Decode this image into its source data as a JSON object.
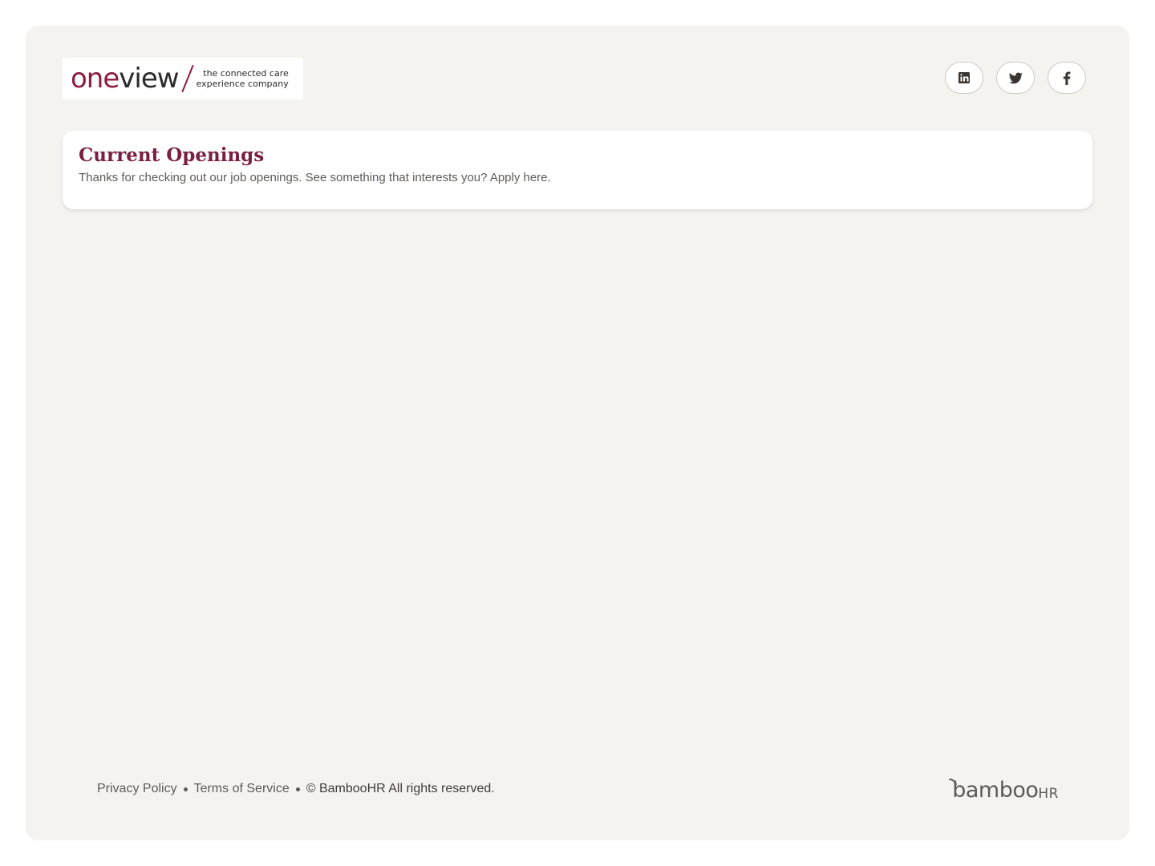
{
  "header": {
    "logo": {
      "word_one": "one",
      "word_view": "view",
      "tagline_line1": "the connected care",
      "tagline_line2": "experience company"
    },
    "social": [
      {
        "name": "linkedin",
        "icon": "linkedin-icon"
      },
      {
        "name": "twitter",
        "icon": "twitter-icon"
      },
      {
        "name": "facebook",
        "icon": "facebook-icon"
      }
    ]
  },
  "openings": {
    "title": "Current Openings",
    "subtitle": "Thanks for checking out our job openings. See something that interests you? Apply here."
  },
  "footer": {
    "privacy_label": "Privacy Policy",
    "terms_label": "Terms of Service",
    "copyright_symbol": "©",
    "copyright_text": "BambooHR All rights reserved.",
    "brand_main": "bamboo",
    "brand_suffix": "HR"
  },
  "colors": {
    "brand": "#7a1f43",
    "background": "#f5f3f0",
    "text_muted": "#5f5a55"
  }
}
